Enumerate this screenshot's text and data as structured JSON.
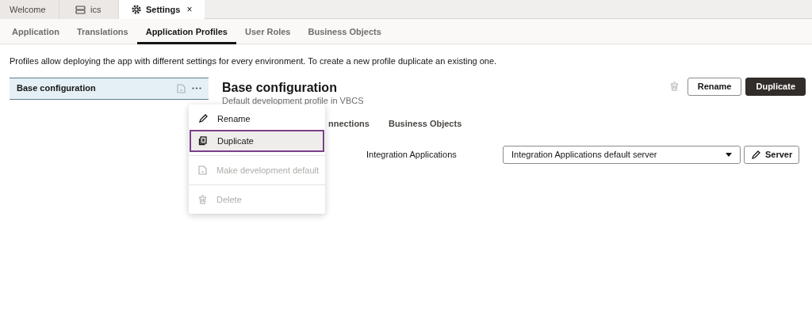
{
  "tabs": [
    {
      "label": "Welcome",
      "selected": false,
      "kind": "plain"
    },
    {
      "label": "ics",
      "selected": false,
      "kind": "server"
    },
    {
      "label": "Settings",
      "selected": true,
      "kind": "settings",
      "close": "×"
    }
  ],
  "settings_tabs": [
    {
      "label": "Application",
      "selected": false
    },
    {
      "label": "Translations",
      "selected": false
    },
    {
      "label": "Application Profiles",
      "selected": true
    },
    {
      "label": "User Roles",
      "selected": false
    },
    {
      "label": "Business Objects",
      "selected": false
    }
  ],
  "description": "Profiles allow deploying the app with different settings for every environment. To create a new profile duplicate an existing one.",
  "profiles": [
    {
      "name": "Base configuration",
      "selected": true
    }
  ],
  "profile": {
    "title": "Base configuration",
    "subtitle": "Default development profile in VBCS",
    "buttons": [
      {
        "label": "Rename",
        "kind": "secondary"
      },
      {
        "label": "Duplicate",
        "kind": "primary"
      }
    ],
    "tabs": [
      {
        "label": "nnections"
      },
      {
        "label": "Business Objects"
      }
    ],
    "setting": {
      "label": "Integration Applications",
      "value": "Integration Applications default server",
      "button": "Server"
    }
  },
  "menu": [
    {
      "label": "Rename",
      "kind": "pencil",
      "selected": false,
      "disabled": false
    },
    {
      "label": "Duplicate",
      "kind": "copy",
      "selected": true,
      "disabled": false
    },
    {
      "label": "Make development default",
      "kind": "doc",
      "selected": false,
      "disabled": true
    },
    {
      "label": "Delete",
      "kind": "trash",
      "selected": false,
      "disabled": true
    }
  ]
}
